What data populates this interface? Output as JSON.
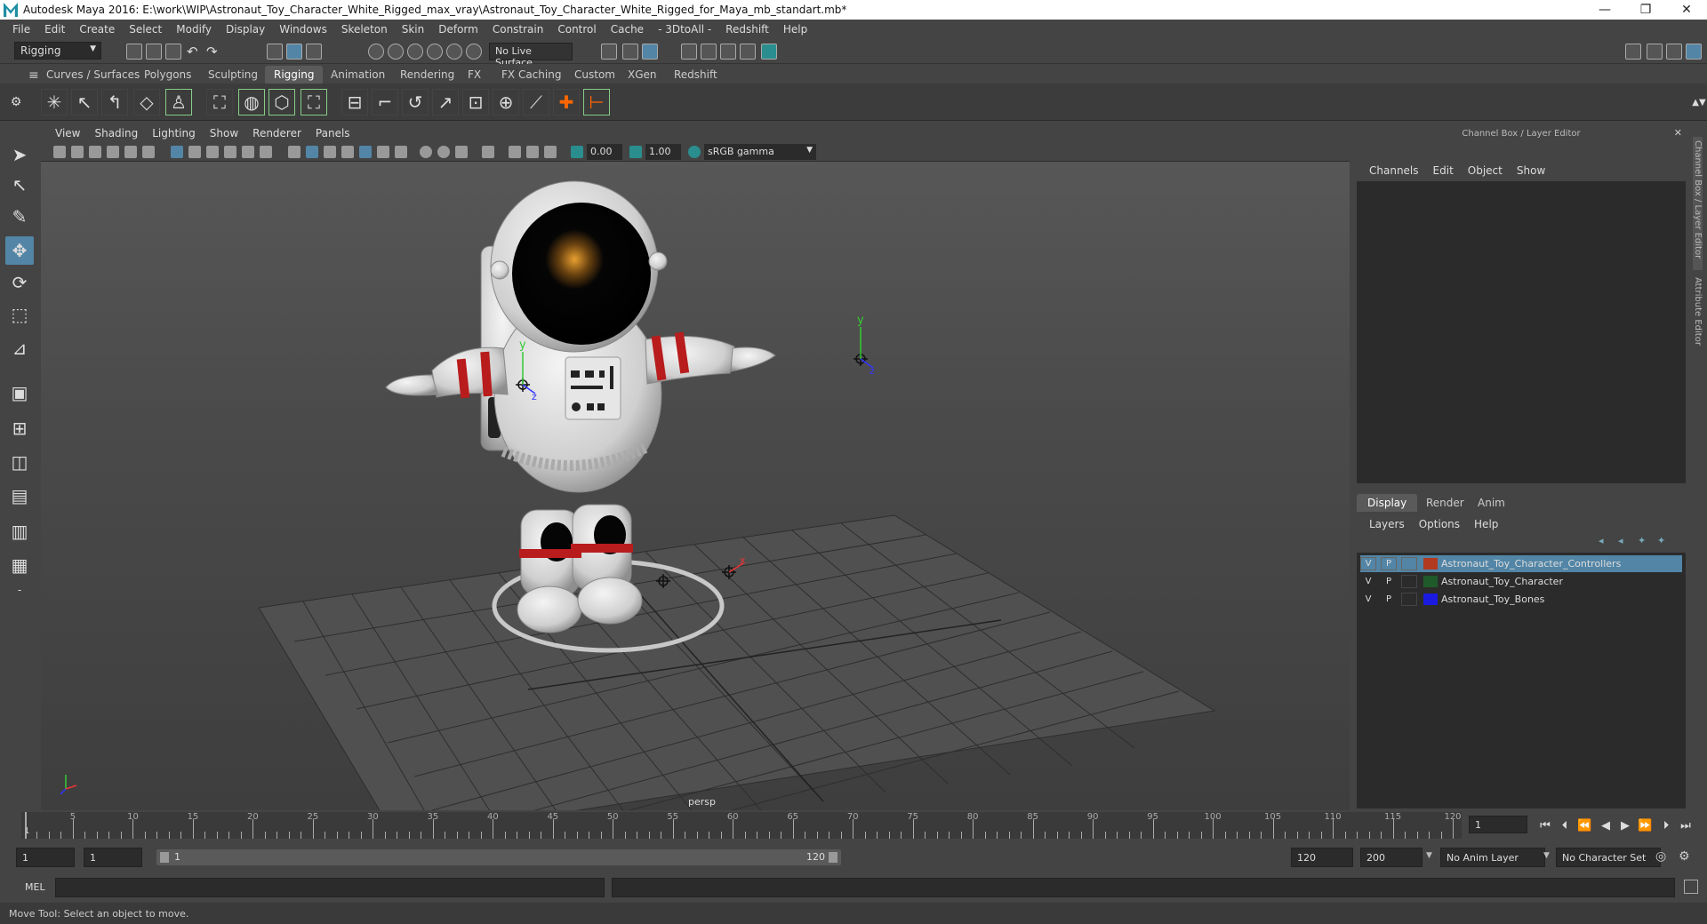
{
  "window": {
    "title": "Autodesk Maya 2016: E:\\work\\WIP\\Astronaut_Toy_Character_White_Rigged_max_vray\\Astronaut_Toy_Character_White_Rigged_for_Maya_mb_standart.mb*",
    "minimize": "—",
    "restore": "❐",
    "close": "✕"
  },
  "menubar": [
    "File",
    "Edit",
    "Create",
    "Select",
    "Modify",
    "Display",
    "Windows",
    "Skeleton",
    "Skin",
    "Deform",
    "Constrain",
    "Control",
    "Cache",
    "- 3DtoAll -",
    "Redshift",
    "Help"
  ],
  "statusline": {
    "mode_selector": "Rigging",
    "live_surface": "No Live Surface"
  },
  "shelf_tabs": [
    "Curves / Surfaces",
    "Polygons",
    "Sculpting",
    "Rigging",
    "Animation",
    "Rendering",
    "FX",
    "FX Caching",
    "Custom",
    "XGen",
    "Redshift"
  ],
  "shelf_active": "Rigging",
  "viewport": {
    "menu": [
      "View",
      "Shading",
      "Lighting",
      "Show",
      "Renderer",
      "Panels"
    ],
    "exposure": "0.00",
    "gamma": "1.00",
    "color_space": "sRGB gamma",
    "camera_label": "persp",
    "axis_y": "y",
    "axis_z": "z",
    "axis_x": "x"
  },
  "channel_box": {
    "title": "Channel Box / Layer Editor",
    "menu": [
      "Channels",
      "Edit",
      "Object",
      "Show"
    ]
  },
  "layer_editor": {
    "tabs": [
      "Display",
      "Render",
      "Anim"
    ],
    "active_tab": "Display",
    "menu": [
      "Layers",
      "Options",
      "Help"
    ],
    "layers": [
      {
        "v": "V",
        "p": "P",
        "name": "Astronaut_Toy_Character_Controllers",
        "color": "#b13a1f",
        "selected": true
      },
      {
        "v": "V",
        "p": "P",
        "name": "Astronaut_Toy_Character",
        "color": "#1f5a2a",
        "selected": false
      },
      {
        "v": "V",
        "p": "P",
        "name": "Astronaut_Toy_Bones",
        "color": "#1a1ae0",
        "selected": false
      }
    ]
  },
  "side_tabs": [
    "Channel Box / Layer Editor",
    "Attribute Editor"
  ],
  "timeline": {
    "ticks": [
      "5",
      "10",
      "15",
      "20",
      "25",
      "30",
      "35",
      "40",
      "45",
      "50",
      "55",
      "60",
      "65",
      "70",
      "75",
      "80",
      "85",
      "90",
      "95",
      "100",
      "105",
      "110",
      "115",
      "120"
    ],
    "current_frame": "1",
    "frame_indicator": "1"
  },
  "range": {
    "start": "1",
    "playback_start": "1",
    "slider_start": "1",
    "slider_end": "120",
    "playback_end": "120",
    "end": "200",
    "anim_layer": "No Anim Layer",
    "character_set": "No Character Set"
  },
  "cmdline": {
    "label": "MEL"
  },
  "helpline": {
    "text": "Move Tool: Select an object to move."
  }
}
